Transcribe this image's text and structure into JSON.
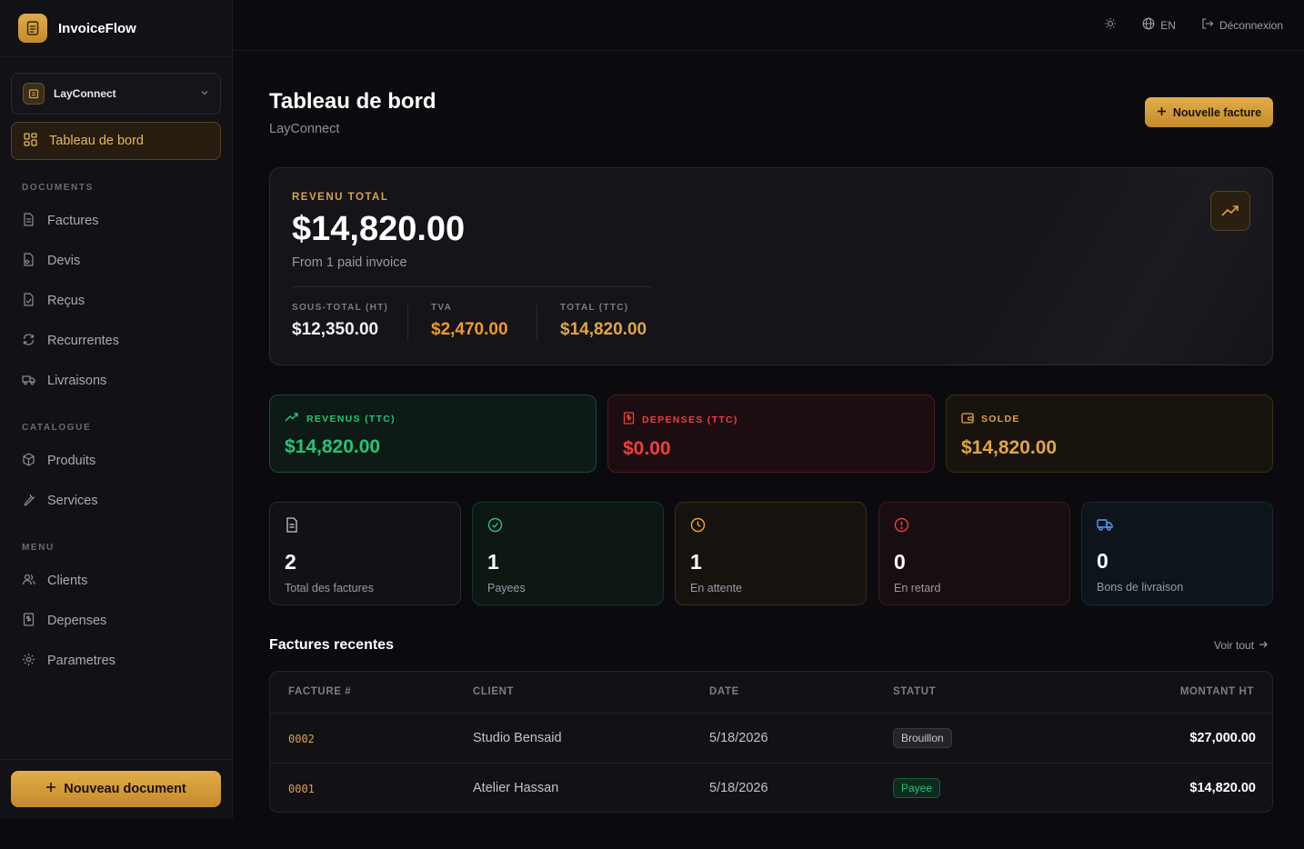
{
  "app": {
    "name": "InvoiceFlow"
  },
  "org": {
    "name": "LayConnect"
  },
  "sidebar": {
    "active": "Tableau de bord",
    "sections": [
      {
        "title": "DOCUMENTS",
        "items": [
          "Factures",
          "Devis",
          "Reçus",
          "Recurrentes",
          "Livraisons"
        ]
      },
      {
        "title": "CATALOGUE",
        "items": [
          "Produits",
          "Services"
        ]
      },
      {
        "title": "MENU",
        "items": [
          "Clients",
          "Depenses",
          "Parametres"
        ]
      }
    ],
    "new_document": "Nouveau document"
  },
  "topbar": {
    "lang": "EN",
    "logout": "Déconnexion"
  },
  "header": {
    "title": "Tableau de bord",
    "subtitle": "LayConnect",
    "new_invoice": "Nouvelle facture"
  },
  "revenue": {
    "label": "REVENU TOTAL",
    "amount": "$14,820.00",
    "from": "From 1 paid invoice",
    "subtotal_label": "SOUS-TOTAL (HT)",
    "subtotal": "$12,350.00",
    "tva_label": "TVA",
    "tva": "$2,470.00",
    "total_label": "TOTAL (TTC)",
    "total": "$14,820.00"
  },
  "summary": [
    {
      "label": "REVENUS (TTC)",
      "value": "$14,820.00",
      "color": "#22c47a"
    },
    {
      "label": "DEPENSES (TTC)",
      "value": "$0.00",
      "color": "#ef3f3f"
    },
    {
      "label": "SOLDE",
      "value": "$14,820.00",
      "color": "#e0a545"
    }
  ],
  "counts": [
    {
      "value": "2",
      "label": "Total des factures"
    },
    {
      "value": "1",
      "label": "Payees"
    },
    {
      "value": "1",
      "label": "En attente"
    },
    {
      "value": "0",
      "label": "En retard"
    },
    {
      "value": "0",
      "label": "Bons de livraison"
    }
  ],
  "recent": {
    "title": "Factures recentes",
    "see_all": "Voir tout",
    "headers": [
      "FACTURE #",
      "CLIENT",
      "DATE",
      "STATUT",
      "MONTANT HT"
    ],
    "rows": [
      {
        "number": "0002",
        "client": "Studio Bensaid",
        "date": "5/18/2026",
        "status": "Brouillon",
        "amount": "$27,000.00"
      },
      {
        "number": "0001",
        "client": "Atelier Hassan",
        "date": "5/18/2026",
        "status": "Payee",
        "amount": "$14,820.00"
      }
    ]
  }
}
